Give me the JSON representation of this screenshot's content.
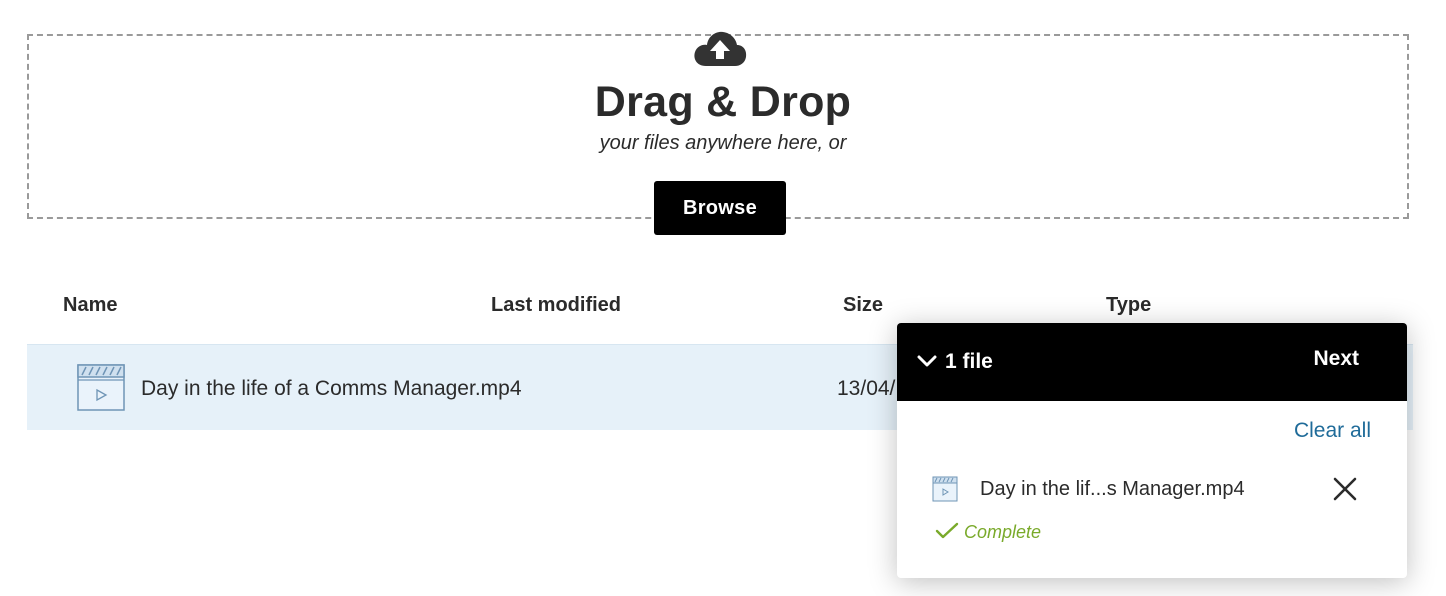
{
  "dropzone": {
    "icon": "cloud-upload-icon",
    "title": "Drag & Drop",
    "subtitle": "your files anywhere here, or",
    "browse_label": "Browse"
  },
  "table": {
    "columns": [
      "Name",
      "Last modified",
      "Size",
      "Type"
    ],
    "rows": [
      {
        "icon": "video-file-icon",
        "name": "Day in the life of a Comms Manager.mp4",
        "modified": "13/04/"
      }
    ]
  },
  "upload_panel": {
    "toggle_icon": "chevron-down-icon",
    "count_label": "1 file",
    "next_label": "Next",
    "clear_all_label": "Clear all",
    "items": [
      {
        "icon": "video-file-icon",
        "name": "Day in the lif...s Manager.mp4",
        "status": "Complete",
        "status_icon": "checkmark-icon",
        "remove_icon": "close-icon"
      }
    ]
  },
  "colors": {
    "accent_link": "#1f6b99",
    "success": "#7aaa2b",
    "row_highlight": "#e6f1f9",
    "header_bg": "#000000"
  }
}
